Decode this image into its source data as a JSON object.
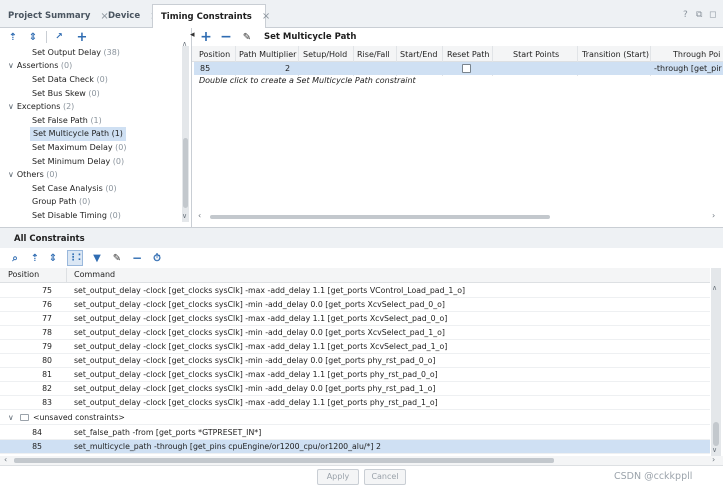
{
  "tabs": [
    {
      "label": "Project Summary",
      "active": false
    },
    {
      "label": "Device",
      "active": false
    },
    {
      "label": "Timing Constraints",
      "active": true
    }
  ],
  "window_controls": {
    "help": "?",
    "restore": "⧉",
    "maximize": "◻"
  },
  "tree": {
    "items": [
      {
        "label": "Set Output Delay",
        "count": "(38)",
        "level": 1,
        "selected": false
      },
      {
        "label": "Assertions",
        "count": "(0)",
        "level": 0,
        "expanded": true
      },
      {
        "label": "Set Data Check",
        "count": "(0)",
        "level": 1
      },
      {
        "label": "Set Bus Skew",
        "count": "(0)",
        "level": 1
      },
      {
        "label": "Exceptions",
        "count": "(2)",
        "level": 0,
        "expanded": true
      },
      {
        "label": "Set False Path",
        "count": "(1)",
        "level": 1
      },
      {
        "label": "Set Multicycle Path",
        "count": "(1)",
        "level": 1,
        "selected": true
      },
      {
        "label": "Set Maximum Delay",
        "count": "(0)",
        "level": 1
      },
      {
        "label": "Set Minimum Delay",
        "count": "(0)",
        "level": 1
      },
      {
        "label": "Others",
        "count": "(0)",
        "level": 0,
        "expanded": true
      },
      {
        "label": "Set Case Analysis",
        "count": "(0)",
        "level": 1
      },
      {
        "label": "Group Path",
        "count": "(0)",
        "level": 1
      },
      {
        "label": "Set Disable Timing",
        "count": "(0)",
        "level": 1
      }
    ]
  },
  "grid": {
    "title": "Set Multicycle Path",
    "headers": [
      "Position",
      "Path Multiplier",
      "Setup/Hold",
      "Rise/Fall",
      "Start/End",
      "Reset Path",
      "Start Points",
      "Transition (Start)",
      "Through Poi"
    ],
    "row": {
      "position": "85",
      "multiplier": "2",
      "through": "-through [get_pir"
    },
    "hint": "Double click to create a Set Multicycle Path constraint"
  },
  "all_constraints": {
    "title": "All Constraints",
    "headers": {
      "position": "Position",
      "command": "Command"
    },
    "rows": [
      {
        "position": "75",
        "command": "set_output_delay -clock [get_clocks sysClk] -max -add_delay 1.1 [get_ports VControl_Load_pad_1_o]"
      },
      {
        "position": "76",
        "command": "set_output_delay -clock [get_clocks sysClk] -min -add_delay 0.0 [get_ports XcvSelect_pad_0_o]"
      },
      {
        "position": "77",
        "command": "set_output_delay -clock [get_clocks sysClk] -max -add_delay 1.1 [get_ports XcvSelect_pad_0_o]"
      },
      {
        "position": "78",
        "command": "set_output_delay -clock [get_clocks sysClk] -min -add_delay 0.0 [get_ports XcvSelect_pad_1_o]"
      },
      {
        "position": "79",
        "command": "set_output_delay -clock [get_clocks sysClk] -max -add_delay 1.1 [get_ports XcvSelect_pad_1_o]"
      },
      {
        "position": "80",
        "command": "set_output_delay -clock [get_clocks sysClk] -min -add_delay 0.0 [get_ports phy_rst_pad_0_o]"
      },
      {
        "position": "81",
        "command": "set_output_delay -clock [get_clocks sysClk] -max -add_delay 1.1 [get_ports phy_rst_pad_0_o]"
      },
      {
        "position": "82",
        "command": "set_output_delay -clock [get_clocks sysClk] -min -add_delay 0.0 [get_ports phy_rst_pad_1_o]"
      },
      {
        "position": "83",
        "command": "set_output_delay -clock [get_clocks sysClk] -max -add_delay 1.1 [get_ports phy_rst_pad_1_o]"
      }
    ],
    "group_label": "<unsaved constraints>",
    "unsaved_rows": [
      {
        "position": "84",
        "command": "set_false_path -from [get_ports *GTPRESET_IN*]"
      },
      {
        "position": "85",
        "command": "set_multicycle_path -through [get_pins cpuEngine/or1200_cpu/or1200_alu/*] 2"
      }
    ]
  },
  "buttons": {
    "apply": "Apply",
    "cancel": "Cancel"
  },
  "watermark": "CSDN @cckkppll",
  "colors": {
    "accent": "#2f6cb2",
    "selection": "#cfe0f3"
  }
}
